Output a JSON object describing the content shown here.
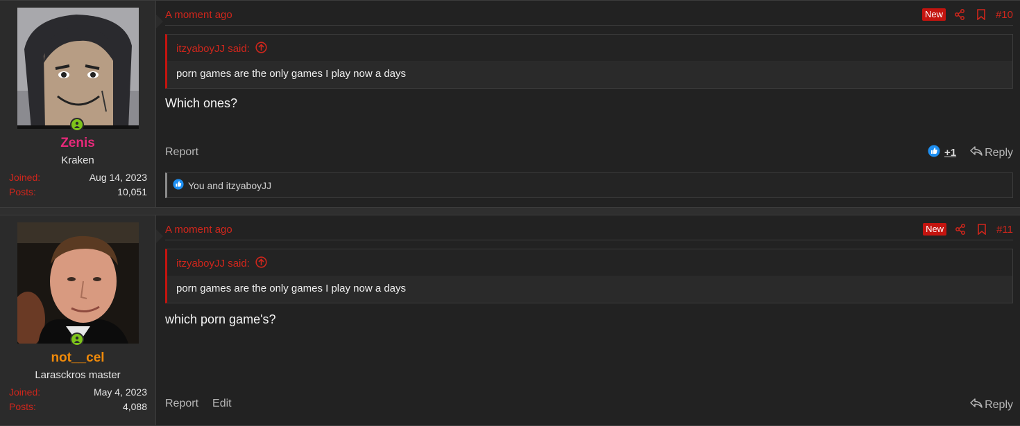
{
  "posts": [
    {
      "user": {
        "name": "Zenis",
        "name_color": "#e8297a",
        "title": "Kraken",
        "joined_label": "Joined:",
        "joined": "Aug 14, 2023",
        "posts_label": "Posts:",
        "posts": "10,051"
      },
      "time": "A moment ago",
      "badge": "New",
      "number": "#10",
      "quote": {
        "author": "itzyaboyJJ said:",
        "text": "porn games are the only games I play now a days"
      },
      "message": "Which ones?",
      "actions": {
        "report": "Report",
        "like_count": "+1",
        "reply": "Reply"
      },
      "reactions": "You and itzyaboyJJ"
    },
    {
      "user": {
        "name": "not__cel",
        "name_color": "#f08a0a",
        "title": "Larasckros master",
        "joined_label": "Joined:",
        "joined": "May 4, 2023",
        "posts_label": "Posts:",
        "posts": "4,088"
      },
      "time": "A moment ago",
      "badge": "New",
      "number": "#11",
      "quote": {
        "author": "itzyaboyJJ said:",
        "text": "porn games are the only games I play now a days"
      },
      "message": "which porn game's?",
      "actions": {
        "report": "Report",
        "edit": "Edit",
        "reply": "Reply"
      }
    }
  ],
  "colors": {
    "accent": "#d0261c",
    "badge": "#c4140f",
    "online": "#7ec41a",
    "like": "#1d8ff2"
  },
  "icons": [
    "share-icon",
    "bookmark-icon",
    "arrow-up-circle-icon",
    "like-icon",
    "reply-icon",
    "online-user-icon"
  ]
}
